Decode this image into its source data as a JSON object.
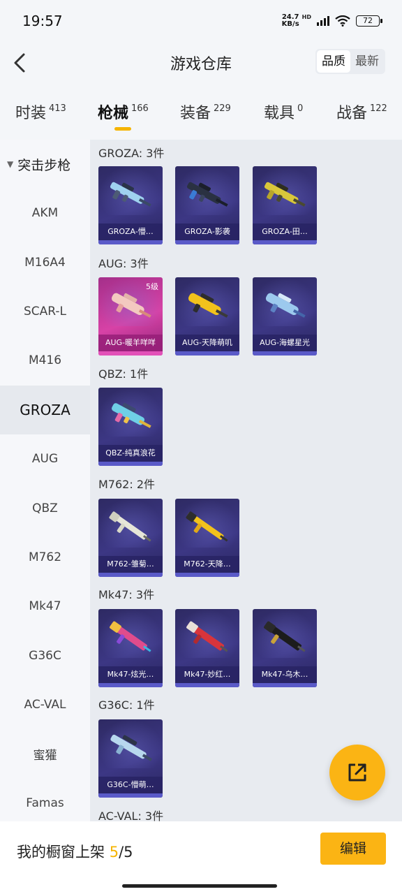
{
  "status": {
    "time": "19:57",
    "net_speed_value": "24.7",
    "net_speed_unit": "KB/s",
    "hd": "HD",
    "battery": "72"
  },
  "header": {
    "title": "游戏仓库",
    "sort_quality": "品质",
    "sort_newest": "最新"
  },
  "tabs": [
    {
      "label": "时装",
      "count": "413"
    },
    {
      "label": "枪械",
      "count": "166"
    },
    {
      "label": "装备",
      "count": "229"
    },
    {
      "label": "载具",
      "count": "0"
    },
    {
      "label": "战备",
      "count": "122"
    }
  ],
  "sidebar": {
    "group": "突击步枪",
    "items": [
      "AKM",
      "M16A4",
      "SCAR-L",
      "M416",
      "GROZA",
      "AUG",
      "QBZ",
      "M762",
      "Mk47",
      "G36C",
      "AC-VAL",
      "蜜獾",
      "Famas"
    ]
  },
  "sections": [
    {
      "title": "GROZA: 3件",
      "items": [
        "GROZA-懵…",
        "GROZA-影袭",
        "GROZA-田…"
      ]
    },
    {
      "title": "AUG: 3件",
      "items": [
        "AUG-暖羊咩咩",
        "AUG-天降萌叽",
        "AUG-海螺星光"
      ],
      "level": "5级"
    },
    {
      "title": "QBZ: 1件",
      "items": [
        "QBZ-纯真浪花"
      ]
    },
    {
      "title": "M762: 2件",
      "items": [
        "M762-雏菊…",
        "M762-天降…"
      ]
    },
    {
      "title": "Mk47: 3件",
      "items": [
        "Mk47-炫光…",
        "Mk47-妙红…",
        "Mk47-乌木…"
      ]
    },
    {
      "title": "G36C: 1件",
      "items": [
        "G36C-懵萌…"
      ]
    },
    {
      "title": "AC-VAL: 3件",
      "items": []
    }
  ],
  "bottom": {
    "window_label": "我的橱窗上架",
    "current": "5",
    "total": "/5",
    "edit_label": "编辑"
  },
  "colors": {
    "accent": "#fbb414",
    "card_purple": "#3c3784",
    "card_pink": "#d742a6"
  }
}
